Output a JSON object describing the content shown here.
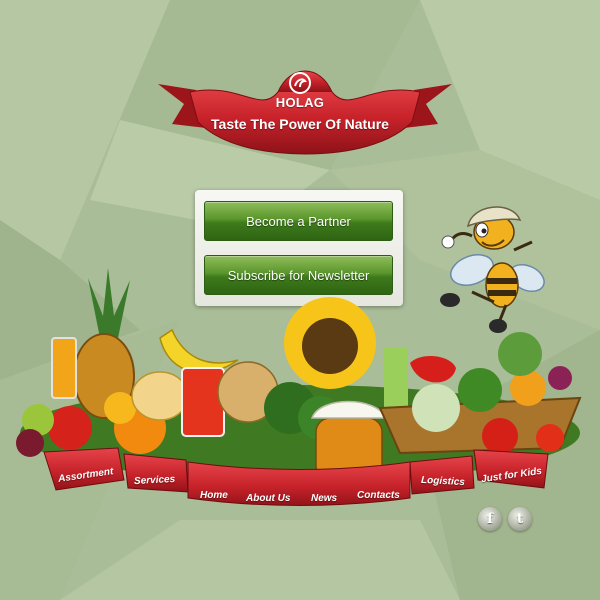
{
  "header": {
    "brand": "HOLAG",
    "tagline": "Taste The Power Of Nature"
  },
  "cta": {
    "partner_label": "Become a Partner",
    "newsletter_label": "Subscribe for Newsletter"
  },
  "nav": {
    "assortment": "Assortment",
    "services": "Services",
    "home": "Home",
    "about": "About Us",
    "news": "News",
    "contacts": "Contacts",
    "logistics": "Logistics",
    "kids": "Just for Kids"
  },
  "social": {
    "facebook_icon": "f",
    "twitter_icon": "t"
  },
  "colors": {
    "background": "#a9bd98",
    "ribbon_red": "#c8232b",
    "button_green": "#4a8a22"
  }
}
